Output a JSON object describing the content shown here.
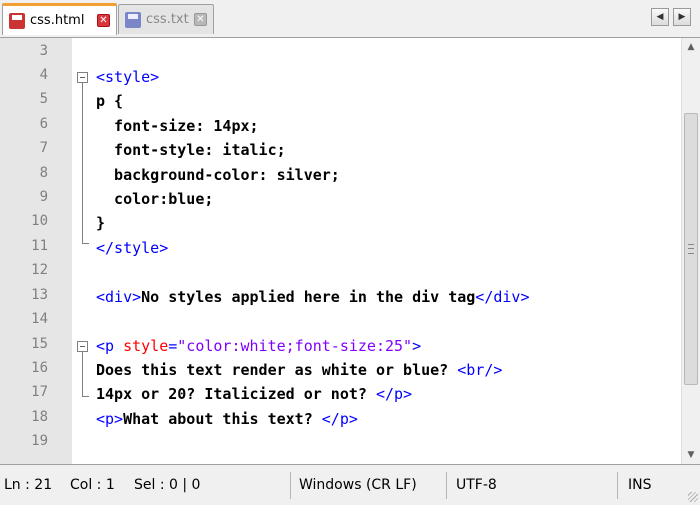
{
  "tabs": [
    {
      "label": "css.html",
      "active": true,
      "icon": "save-disk-red-icon"
    },
    {
      "label": "css.txt",
      "active": false,
      "icon": "save-disk-blue-icon"
    }
  ],
  "editor": {
    "line_numbers": [
      "3",
      "4",
      "5",
      "6",
      "7",
      "8",
      "9",
      "10",
      "11",
      "12",
      "13",
      "14",
      "15",
      "16",
      "17",
      "18",
      "19"
    ]
  },
  "statusbar": {
    "ln": "Ln : 21",
    "col": "Col : 1",
    "sel": "Sel : 0 | 0",
    "eol": "Windows (CR LF)",
    "encoding": "UTF-8",
    "mode": "INS"
  },
  "colors": {
    "tag": "#0000ff",
    "attribute": "#ff0000",
    "attr_value": "#8000ff",
    "active_tab_accent": "#f3a033"
  }
}
